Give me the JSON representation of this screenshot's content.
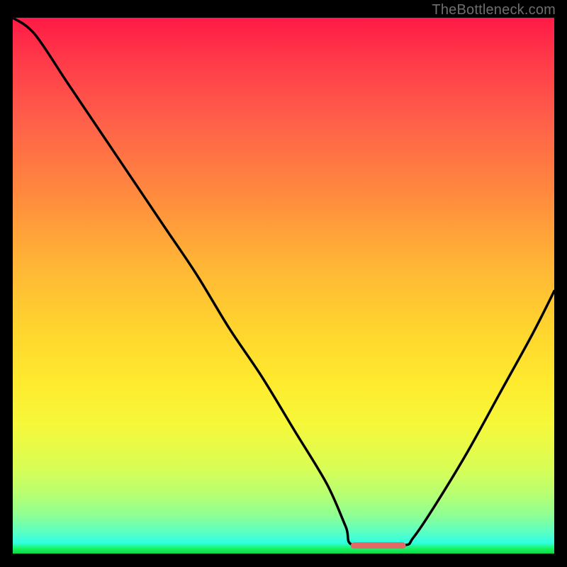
{
  "watermark": "TheBottleneck.com",
  "colors": {
    "page_bg": "#000000",
    "curve_stroke": "#000000",
    "flat_segment_stroke": "#e36a64",
    "watermark_text": "#6e6e6e"
  },
  "chart_data": {
    "type": "line",
    "title": "",
    "xlabel": "",
    "ylabel": "",
    "xlim": [
      0,
      100
    ],
    "ylim": [
      0,
      100
    ],
    "grid": false,
    "note": "No axes, ticks, or labels are visible. Values are estimated from pixel positions and are approximate.",
    "series": [
      {
        "name": "bottleneck-curve",
        "x": [
          0,
          4,
          10,
          16,
          22,
          28,
          34,
          40,
          46,
          52,
          58,
          61.5,
          63,
          72,
          74,
          78,
          84,
          90,
          96,
          100
        ],
        "values": [
          100,
          97,
          88,
          79,
          70,
          61,
          52,
          42,
          33,
          23,
          13,
          5,
          1.5,
          1.5,
          3,
          9,
          19,
          30,
          41,
          49
        ]
      }
    ],
    "flat_segment": {
      "x_start": 63,
      "x_end": 72,
      "y": 1.5
    }
  }
}
